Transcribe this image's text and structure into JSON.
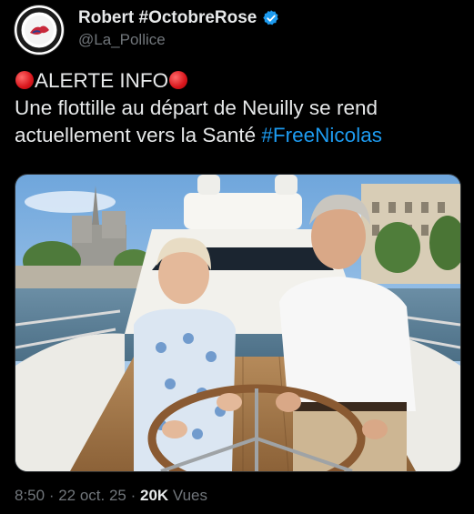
{
  "author": {
    "display_name": "Robert #OctobreRose",
    "handle": "@La_Pollice",
    "avatar_icon": "police-badge-logo-icon",
    "verified_icon": "verified-badge-icon",
    "verified_color": "#1d9bf0"
  },
  "tweet": {
    "alert_label": "ALERTE INFO",
    "alert_icon": "red-circle-emoji-icon",
    "line2": "Une flottille au départ de Neuilly se rend",
    "line3_text": "actuellement vers la Santé ",
    "hashtag": "#FreeNicolas",
    "hashtag_color": "#1d9bf0"
  },
  "media": {
    "type": "photo",
    "description_icon": "yacht-photo"
  },
  "footer": {
    "time": "8:50",
    "sep1": " · ",
    "date": "22 oct. 25",
    "sep2": " · ",
    "views_count": "20K",
    "views_label": " Vues"
  }
}
